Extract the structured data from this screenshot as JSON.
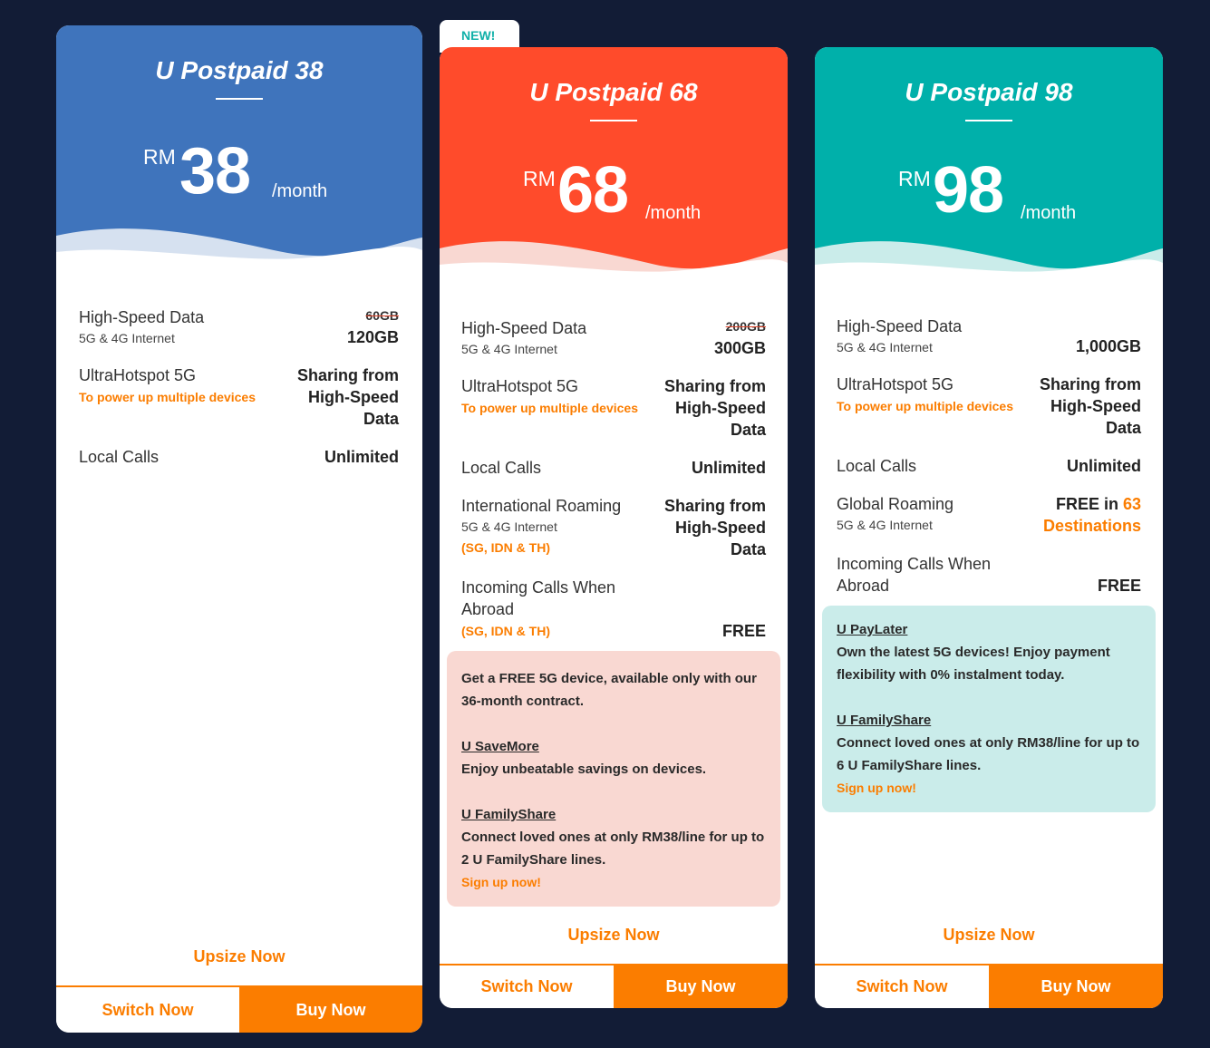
{
  "colors": {
    "background": "#121c36",
    "accent_orange": "#fb7d00",
    "badge_text": "#10b0a8"
  },
  "badge": {
    "label": "NEW!"
  },
  "plans": [
    {
      "title": "U Postpaid 38",
      "color": "#3f74bc",
      "wave_color": "#d6e1f0",
      "currency": "RM",
      "amount": "38",
      "period": "/month",
      "features": [
        {
          "label": "High-Speed Data",
          "sub": "5G & 4G Internet",
          "old_value": "60GB",
          "value": "120GB"
        },
        {
          "label": "UltraHotspot 5G",
          "note": "To power up multiple devices",
          "value": "Sharing from High-Speed Data"
        },
        {
          "label": "Local Calls",
          "value": "Unlimited"
        }
      ],
      "upsize_label": "Upsize Now",
      "switch_label": "Switch Now",
      "buy_label": "Buy Now"
    },
    {
      "title": "U Postpaid 68",
      "color": "#ff4b2b",
      "wave_color": "#f9d8d2",
      "currency": "RM",
      "amount": "68",
      "period": "/month",
      "features": [
        {
          "label": "High-Speed Data",
          "sub": "5G & 4G Internet",
          "old_value": "200GB",
          "value": "300GB"
        },
        {
          "label": "UltraHotspot 5G",
          "note": "To power up multiple devices",
          "value": "Sharing from High-Speed Data"
        },
        {
          "label": "Local Calls",
          "value": "Unlimited"
        },
        {
          "label": "International Roaming",
          "sub": "5G & 4G Internet",
          "note": "(SG, IDN & TH)",
          "value": "Sharing from High-Speed Data"
        },
        {
          "label": "Incoming Calls When Abroad",
          "note": "(SG, IDN & TH)",
          "value": "FREE"
        }
      ],
      "promo": {
        "intro": "Get a FREE 5G device, available only with our 36-month contract.",
        "sections": [
          {
            "heading": "U SaveMore",
            "text": "Enjoy unbeatable savings on devices."
          },
          {
            "heading": "U FamilyShare",
            "text": "Connect loved ones at only RM38/line for up to 2 U FamilyShare lines."
          }
        ],
        "signup": "Sign up now!"
      },
      "upsize_label": "Upsize Now",
      "switch_label": "Switch Now",
      "buy_label": "Buy Now"
    },
    {
      "title": "U Postpaid 98",
      "color": "#00b0aa",
      "wave_color": "#caecea",
      "currency": "RM",
      "amount": "98",
      "period": "/month",
      "features": [
        {
          "label": "High-Speed Data",
          "sub": "5G & 4G Internet",
          "value": "1,000GB"
        },
        {
          "label": "UltraHotspot 5G",
          "note": "To power up multiple devices",
          "value": "Sharing from High-Speed Data"
        },
        {
          "label": "Local Calls",
          "value": "Unlimited"
        },
        {
          "label": "Global Roaming",
          "sub": "5G & 4G Internet",
          "value_prefix": "FREE in ",
          "value_accent": "63 Destinations"
        },
        {
          "label": "Incoming Calls When Abroad",
          "value": "FREE"
        }
      ],
      "promo": {
        "sections": [
          {
            "heading": "U PayLater",
            "text": "Own the latest 5G devices! Enjoy payment flexibility with 0% instalment today."
          },
          {
            "heading": "U FamilyShare",
            "text": "Connect loved ones at only RM38/line for up to 6 U FamilyShare lines."
          }
        ],
        "signup": "Sign up now!"
      },
      "upsize_label": "Upsize Now",
      "switch_label": "Switch Now",
      "buy_label": "Buy Now"
    }
  ]
}
